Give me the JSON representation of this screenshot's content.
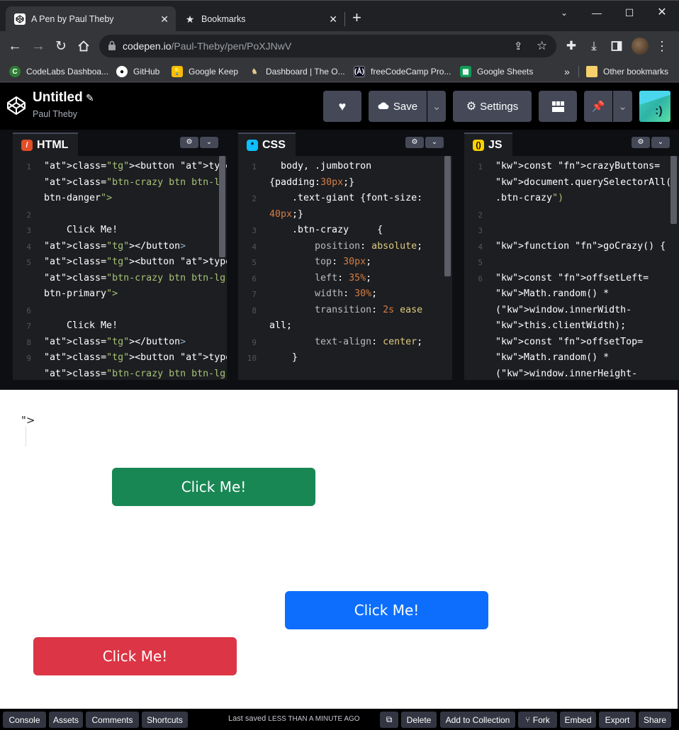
{
  "browser": {
    "tabs": [
      {
        "title": "A Pen by Paul Theby",
        "active": true
      },
      {
        "title": "Bookmarks",
        "active": false
      }
    ],
    "new_tab": "+",
    "url_host": "codepen.io",
    "url_path": "/Paul-Theby/pen/PoXJNwV",
    "bookmarks": [
      "CodeLabs Dashboa...",
      "GitHub",
      "Google Keep",
      "Dashboard | The O...",
      "freeCodeCamp Pro...",
      "Google Sheets"
    ],
    "bookmarks_more": "»",
    "other_bookmarks": "Other bookmarks"
  },
  "codepen": {
    "title": "Untitled",
    "author": "Paul Theby",
    "save_label": "Save",
    "settings_label": "Settings"
  },
  "editors": {
    "html": {
      "name": "HTML",
      "line_numbers": [
        "1",
        "",
        "",
        "2",
        "3",
        "4",
        "5",
        "",
        "",
        "6",
        "7",
        "8",
        "9",
        ""
      ],
      "lines": [
        "<button type=\"button\"",
        "class=\"btn-crazy btn btn-lg",
        "btn-danger\">",
        "",
        "    Click Me!",
        "</button>",
        "<button type=\"button\"",
        "class=\"btn-crazy btn btn-lg",
        "btn-primary\">",
        "",
        "    Click Me!",
        "</button>",
        "<button type=\"button\"",
        "class=\"btn-crazy btn btn-lg"
      ]
    },
    "css": {
      "name": "CSS",
      "line_numbers": [
        "1",
        "",
        "2",
        "",
        "3",
        "4",
        "5",
        "6",
        "7",
        "8",
        "",
        "9",
        "10"
      ],
      "lines": [
        "  body, .jumbotron",
        "{padding:30px;}",
        "    .text-giant {font-size:",
        "40px;}",
        "    .btn-crazy     {",
        "        position: absolute;",
        "        top: 30px;",
        "        left: 35%;",
        "        width: 30%;",
        "        transition: 2s ease",
        "all;",
        "        text-align: center;",
        "    }"
      ]
    },
    "js": {
      "name": "JS",
      "line_numbers": [
        "1",
        "",
        "",
        "2",
        "3",
        "4",
        "5",
        "6",
        "",
        "",
        "",
        "",
        "",
        ""
      ],
      "lines": [
        "const crazyButtons=",
        "document.querySelectorAll(\"",
        ".btn-crazy\")",
        "",
        "",
        "function goCrazy() {",
        "",
        "const offsetLeft=",
        "Math.random() *",
        "(window.innerWidth-",
        "this.clientWidth);",
        "const offsetTop=",
        "Math.random() *",
        "(window.innerHeight-"
      ]
    }
  },
  "preview": {
    "stray_text": "\">",
    "buttons": [
      {
        "label": "Click Me!",
        "color": "#198754"
      },
      {
        "label": "Click Me!",
        "color": "#0d6efd"
      },
      {
        "label": "Click Me!",
        "color": "#dc3545"
      }
    ]
  },
  "footer": {
    "console": "Console",
    "assets": "Assets",
    "comments": "Comments",
    "shortcuts": "Shortcuts",
    "last_saved_prefix": "Last saved",
    "last_saved_time": "LESS THAN A MINUTE AGO",
    "delete": "Delete",
    "add_collection": "Add to Collection",
    "fork": "Fork",
    "embed": "Embed",
    "export": "Export",
    "share": "Share"
  },
  "colors": {
    "html_icon": "#e44d26",
    "css_icon": "#0ebeff",
    "js_icon": "#fcd000"
  }
}
